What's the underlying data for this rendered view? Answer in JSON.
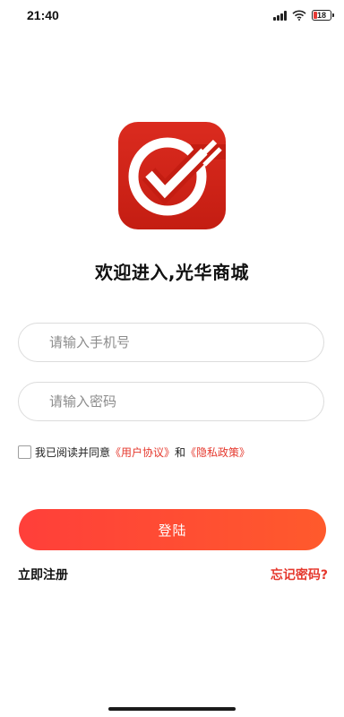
{
  "status_bar": {
    "time": "21:40",
    "battery_level": "18",
    "icons": [
      "signal-icon",
      "wifi-icon",
      "battery-icon"
    ]
  },
  "logo": {
    "icon": "check-circle-logo-icon",
    "background_color": "#d1251a"
  },
  "welcome": {
    "title": "欢迎进入,光华商城"
  },
  "form": {
    "phone_placeholder": "请输入手机号",
    "phone_value": "",
    "password_placeholder": "请输入密码",
    "password_value": "",
    "agreement": {
      "prefix": "我已阅读并同意",
      "user_agreement": "《用户协议》",
      "conjunction": "和",
      "privacy_policy": "《隐私政策》",
      "checked": false
    },
    "login_label": "登陆"
  },
  "footer": {
    "register_label": "立即注册",
    "forgot_label": "忘记密码?"
  },
  "colors": {
    "accent": "#ff4a33",
    "link": "#e5382d"
  }
}
